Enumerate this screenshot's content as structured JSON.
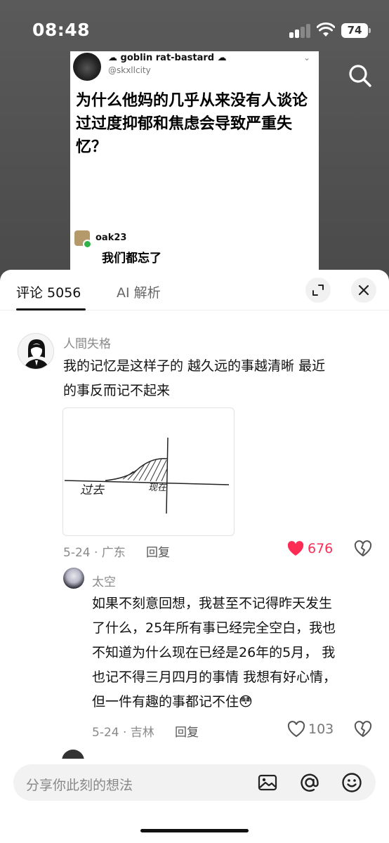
{
  "status": {
    "time": "08:48",
    "battery": "74"
  },
  "post": {
    "author_name": "☁ goblin rat-bastard ☁",
    "author_handle": "@skxllcity",
    "text": "为什么他妈的几乎从来没有人谈论过过度抑郁和焦虑会导致严重失忆？",
    "reply_name": "oak23",
    "reply_text": "我们都忘了"
  },
  "tabs": {
    "comments_label": "评论 5056",
    "ai_label": "AI 解析"
  },
  "comments": [
    {
      "name": "人間失格",
      "line1": "我的记忆是这样子的 越久远的事越清晰 最近",
      "line2": "的事反而记不起来",
      "sketch_past": "过去",
      "sketch_now": "现在",
      "meta": "5-24 · 广东",
      "reply_label": "回复",
      "likes": "676",
      "liked": true
    },
    {
      "name": "太空",
      "line1": "如果不刻意回想，我甚至不记得昨天发生",
      "line2": "了什么，25年所有事已经完全空白，我也",
      "line3": "不知道为什么现在已经是26年的5月， 我",
      "line4": "也记不得三月四月的事情 我想有好心情，",
      "line5": "但一件有趣的事都记不住😳",
      "meta": "5-24 · 吉林",
      "reply_label": "回复",
      "likes": "103",
      "liked": false
    }
  ],
  "input": {
    "placeholder": "分享你此刻的想法"
  },
  "colors": {
    "like_red": "#fe2c55",
    "text_gray": "#8a8a8a"
  }
}
